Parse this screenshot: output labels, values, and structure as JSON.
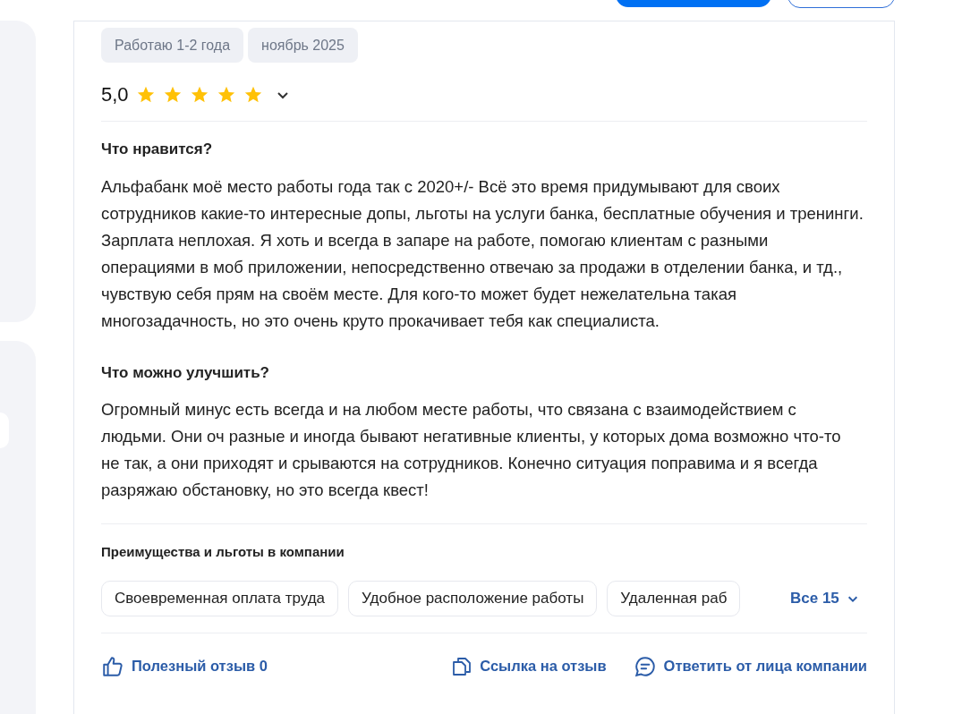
{
  "tags": [
    "Работаю 1-2 года",
    "ноябрь 2025"
  ],
  "rating": {
    "value": "5,0",
    "stars": 5
  },
  "sections": [
    {
      "title": "Что нравится?",
      "text": "Альфабанк моё место работы года так с 2020+/- Всё это время придумывают для своих сотрудников какие-то интересные допы, льготы на услуги банка, бесплатные обучения и тренинги. Зарплата неплохая. Я хоть и всегда в запаре на работе, помогаю клиентам с разными операциями в моб приложении, непосредственно отвечаю за продажи в отделении банка, и тд., чувствую себя прям на своём месте. Для кого-то может будет нежелательна такая многозадачность, но это очень круто прокачивает тебя как специалиста."
    },
    {
      "title": "Что можно улучшить?",
      "text": "Огромный минус есть всегда и на любом месте работы, что связана с взаимодействием с людьми. Они оч разные и иногда бывают негативные клиенты, у которых дома возможно что-то не так, а они приходят и срываются на сотрудников. Конечно ситуация поправима и я всегда разряжаю обстановку, но это всегда квест!"
    }
  ],
  "benefits": {
    "title": "Преимущества и льготы в компании",
    "items": [
      "Своевременная оплата труда",
      "Удобное расположение работы",
      "Удаленная раб"
    ],
    "more": "Все 15"
  },
  "actions": [
    {
      "kind": "like",
      "label": "Полезный отзыв 0"
    },
    {
      "kind": "link",
      "label": "Ссылка на отзыв"
    },
    {
      "kind": "reply",
      "label": "Ответить от лица компании"
    }
  ]
}
